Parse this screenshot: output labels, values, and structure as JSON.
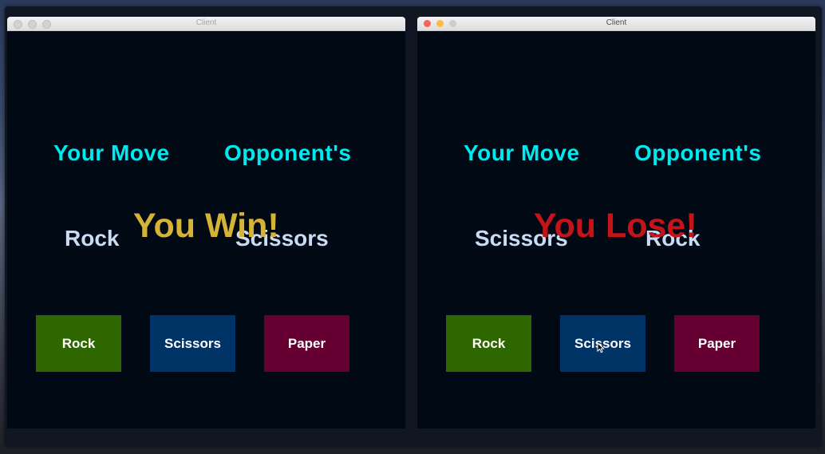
{
  "left_window": {
    "title": "Client",
    "your_move_heading": "Your Move",
    "opponent_heading": "Opponent's",
    "your_move": "Rock",
    "opponent_move": "Scissors",
    "result": "You Win!",
    "buttons": [
      "Rock",
      "Scissors",
      "Paper"
    ]
  },
  "right_window": {
    "title": "Client",
    "your_move_heading": "Your Move",
    "opponent_heading": "Opponent's",
    "your_move": "Scissors",
    "opponent_move": "Rock",
    "result": "You Lose!",
    "buttons": [
      "Rock",
      "Scissors",
      "Paper"
    ]
  },
  "colors": {
    "heading": "#00e9ef",
    "move_text": "#c9dbf5",
    "win": "#d5b336",
    "lose": "#c4141a",
    "rock_button": "#2e6600",
    "scissors_button": "#003366",
    "paper_button": "#660033",
    "game_background": "#010915"
  },
  "icons": [
    "mouse-pointer-icon"
  ]
}
